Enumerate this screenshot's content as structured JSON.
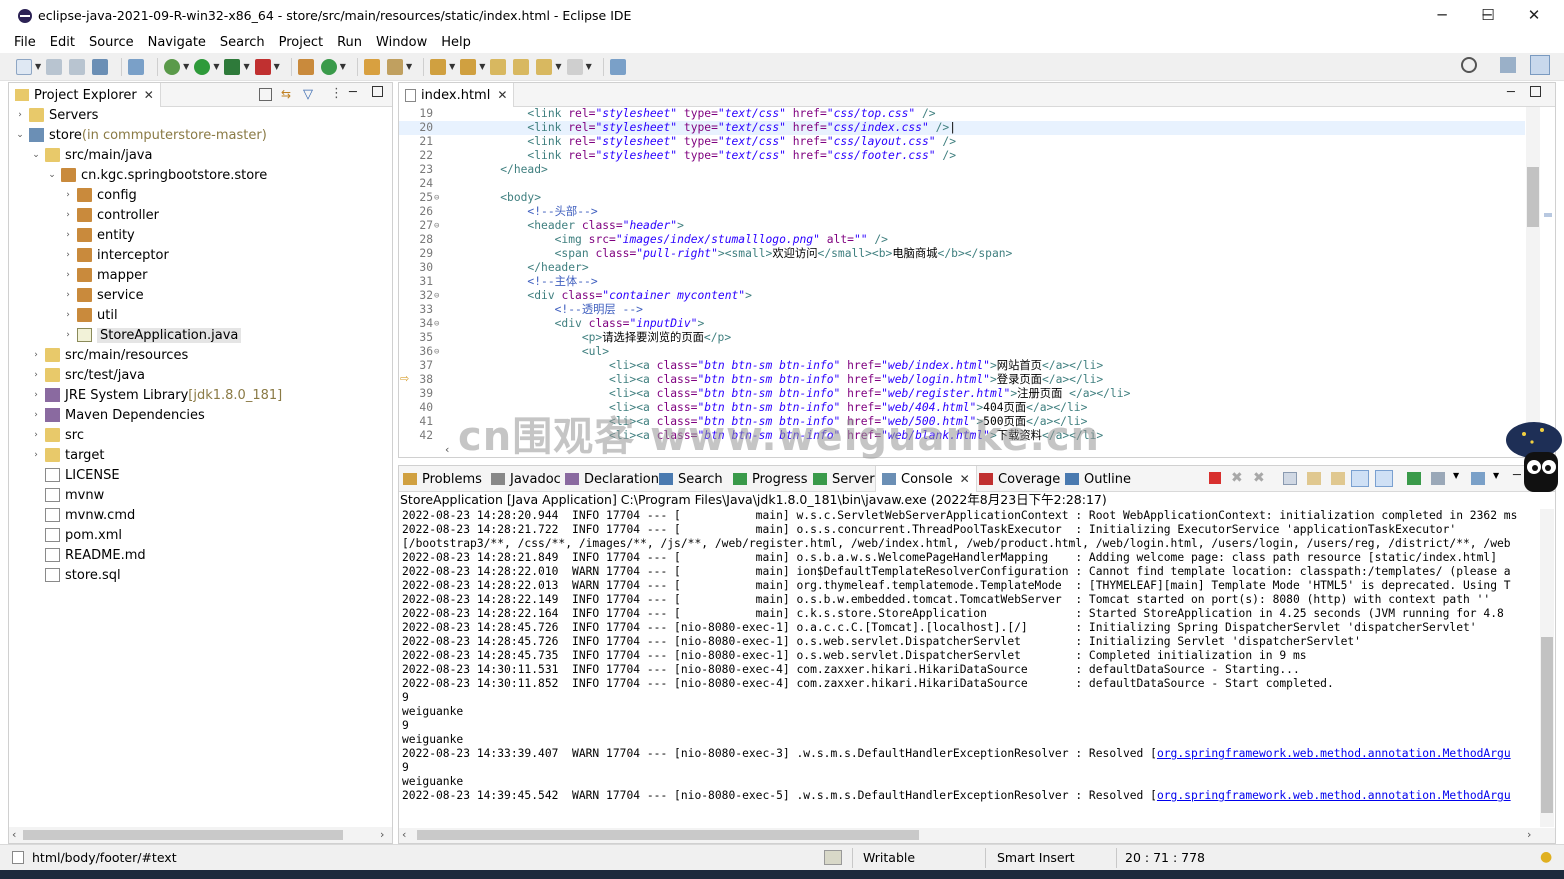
{
  "window": {
    "title": "eclipse-java-2021-09-R-win32-x86_64 - store/src/main/resources/static/index.html - Eclipse IDE",
    "minimize": "─",
    "maximize": "☐",
    "close": "✕"
  },
  "menu": [
    "File",
    "Edit",
    "Source",
    "Navigate",
    "Search",
    "Project",
    "Run",
    "Window",
    "Help"
  ],
  "explorer": {
    "tab_label": "Project Explorer",
    "items": [
      {
        "label": "Servers",
        "extra": ""
      },
      {
        "label": "store",
        "extra": " (in commputerstore-master)"
      },
      {
        "label": "src/main/java",
        "extra": ""
      },
      {
        "label": "cn.kgc.springbootstore.store",
        "extra": ""
      },
      {
        "label": "config",
        "extra": ""
      },
      {
        "label": "controller",
        "extra": ""
      },
      {
        "label": "entity",
        "extra": ""
      },
      {
        "label": "interceptor",
        "extra": ""
      },
      {
        "label": "mapper",
        "extra": ""
      },
      {
        "label": "service",
        "extra": ""
      },
      {
        "label": "util",
        "extra": ""
      },
      {
        "label": "StoreApplication.java",
        "extra": ""
      },
      {
        "label": "src/main/resources",
        "extra": ""
      },
      {
        "label": "src/test/java",
        "extra": ""
      },
      {
        "label": "JRE System Library",
        "extra": " [jdk1.8.0_181]"
      },
      {
        "label": "Maven Dependencies",
        "extra": ""
      },
      {
        "label": "src",
        "extra": ""
      },
      {
        "label": "target",
        "extra": ""
      },
      {
        "label": "LICENSE",
        "extra": ""
      },
      {
        "label": "mvnw",
        "extra": ""
      },
      {
        "label": "mvnw.cmd",
        "extra": ""
      },
      {
        "label": "pom.xml",
        "extra": ""
      },
      {
        "label": "README.md",
        "extra": ""
      },
      {
        "label": "store.sql",
        "extra": ""
      }
    ]
  },
  "editor": {
    "tab_label": "index.html",
    "lines": [
      {
        "n": "19",
        "html": "        <span class='k'>&lt;link</span> <span class='a'>rel=</span><span class='v'>\"stylesheet\"</span> <span class='a'>type=</span><span class='v'>\"text/css\"</span> <span class='a'>href=</span><span class='v'>\"css/top.css\"</span> <span class='k'>/&gt;</span>"
      },
      {
        "n": "20",
        "html": "        <span class='k'>&lt;link</span> <span class='a'>rel=</span><span class='v'>\"stylesheet\"</span> <span class='a'>type=</span><span class='v'>\"text/css\"</span> <span class='a'>href=</span><span class='v'>\"css/index.css\"</span> <span class='k'>/&gt;</span>|"
      },
      {
        "n": "21",
        "html": "        <span class='k'>&lt;link</span> <span class='a'>rel=</span><span class='v'>\"stylesheet\"</span> <span class='a'>type=</span><span class='v'>\"text/css\"</span> <span class='a'>href=</span><span class='v'>\"css/layout.css\"</span> <span class='k'>/&gt;</span>"
      },
      {
        "n": "22",
        "html": "        <span class='k'>&lt;link</span> <span class='a'>rel=</span><span class='v'>\"stylesheet\"</span> <span class='a'>type=</span><span class='v'>\"text/css\"</span> <span class='a'>href=</span><span class='v'>\"css/footer.css\"</span> <span class='k'>/&gt;</span>"
      },
      {
        "n": "23",
        "html": "    <span class='k'>&lt;/head&gt;</span>"
      },
      {
        "n": "24",
        "html": ""
      },
      {
        "n": "25",
        "html": "    <span class='k'>&lt;body&gt;</span>"
      },
      {
        "n": "26",
        "html": "        <span class='c'>&lt;!--头部--&gt;</span>"
      },
      {
        "n": "27",
        "html": "        <span class='k'>&lt;header</span> <span class='a'>class=</span><span class='v'>\"header\"</span><span class='k'>&gt;</span>"
      },
      {
        "n": "28",
        "html": "            <span class='k'>&lt;img</span> <span class='a'>src=</span><span class='v'>\"images/index/stumalllogo.png\"</span> <span class='a'>alt=</span><span class='v'>\"\"</span> <span class='k'>/&gt;</span>"
      },
      {
        "n": "29",
        "html": "            <span class='k'>&lt;span</span> <span class='a'>class=</span><span class='v'>\"pull-right\"</span><span class='k'>&gt;&lt;small&gt;</span>欢迎访问<span class='k'>&lt;/small&gt;&lt;b&gt;</span>电脑商城<span class='k'>&lt;/b&gt;&lt;/span&gt;</span>"
      },
      {
        "n": "30",
        "html": "        <span class='k'>&lt;/header&gt;</span>"
      },
      {
        "n": "31",
        "html": "        <span class='c'>&lt;!--主体--&gt;</span>"
      },
      {
        "n": "32",
        "html": "        <span class='k'>&lt;div</span> <span class='a'>class=</span><span class='v'>\"container mycontent\"</span><span class='k'>&gt;</span>"
      },
      {
        "n": "33",
        "html": "            <span class='c'>&lt;!--透明层 --&gt;</span>"
      },
      {
        "n": "34",
        "html": "            <span class='k'>&lt;div</span> <span class='a'>class=</span><span class='v'>\"inputDiv\"</span><span class='k'>&gt;</span>"
      },
      {
        "n": "35",
        "html": "                <span class='k'>&lt;p&gt;</span>请选择要浏览的页面<span class='k'>&lt;/p&gt;</span>"
      },
      {
        "n": "36",
        "html": "                <span class='k'>&lt;ul&gt;</span>"
      },
      {
        "n": "37",
        "html": "                    <span class='k'>&lt;li&gt;&lt;a</span> <span class='a'>class=</span><span class='v'>\"btn btn-sm btn-info\"</span> <span class='a'>href=</span><span class='v'>\"web/index.html\"</span><span class='k'>&gt;</span>网站首页<span class='k'>&lt;/a&gt;&lt;/li&gt;</span>"
      },
      {
        "n": "38",
        "html": "                    <span class='k'>&lt;li&gt;&lt;a</span> <span class='a'>class=</span><span class='v'>\"btn btn-sm btn-info\"</span> <span class='a'>href=</span><span class='v'>\"web/login.html\"</span><span class='k'>&gt;</span>登录页面<span class='k'>&lt;/a&gt;&lt;/li&gt;</span>"
      },
      {
        "n": "39",
        "html": "                    <span class='k'>&lt;li&gt;&lt;a</span> <span class='a'>class=</span><span class='v'>\"btn btn-sm btn-info\"</span> <span class='a'>href=</span><span class='v'>\"web/register.html\"</span><span class='k'>&gt;</span>注册页面 <span class='k'>&lt;/a&gt;&lt;/li&gt;</span>"
      },
      {
        "n": "40",
        "html": "                    <span class='k'>&lt;li&gt;&lt;a</span> <span class='a'>class=</span><span class='v'>\"btn btn-sm btn-info\"</span> <span class='a'>href=</span><span class='v'>\"web/404.html\"</span><span class='k'>&gt;</span>404页面<span class='k'>&lt;/a&gt;&lt;/li&gt;</span>"
      },
      {
        "n": "41",
        "html": "                    <span class='k'>&lt;li&gt;&lt;a</span> <span class='a'>class=</span><span class='v'>\"btn btn-sm btn-info\"</span> <span class='a'>href=</span><span class='v'>\"web/500.html\"</span><span class='k'>&gt;</span>500页面<span class='k'>&lt;/a&gt;&lt;/li&gt;</span>"
      },
      {
        "n": "42",
        "html": "                    <span class='k'>&lt;li&gt;&lt;a</span> <span class='a'>class=</span><span class='v'>\"btn btn-sm btn-info\"</span> <span class='a'>href=</span><span class='v'>\"web/blank.html\"</span><span class='k'>&gt;</span>下载资料<span class='k'>&lt;/a&gt;&lt;/li&gt;</span>"
      }
    ]
  },
  "console_tabs": [
    "Problems",
    "Javadoc",
    "Declaration",
    "Search",
    "Progress",
    "Servers",
    "Console",
    "Coverage",
    "Outline"
  ],
  "console": {
    "header": "StoreApplication [Java Application] C:\\Program Files\\Java\\jdk1.8.0_181\\bin\\javaw.exe  (2022年8月23日下午2:28:17)",
    "lines": [
      "2022-08-23 14:28:20.944  INFO 17704 --- [           main] w.s.c.ServletWebServerApplicationContext : Root WebApplicationContext: initialization completed in 2362 ms",
      "2022-08-23 14:28:21.722  INFO 17704 --- [           main] o.s.s.concurrent.ThreadPoolTaskExecutor  : Initializing ExecutorService 'applicationTaskExecutor'",
      "[/bootstrap3/**, /css/**, /images/**, /js/**, /web/register.html, /web/index.html, /web/product.html, /web/login.html, /users/login, /users/reg, /district/**, /web",
      "2022-08-23 14:28:21.849  INFO 17704 --- [           main] o.s.b.a.w.s.WelcomePageHandlerMapping    : Adding welcome page: class path resource [static/index.html]",
      "2022-08-23 14:28:22.010  WARN 17704 --- [           main] ion$DefaultTemplateResolverConfiguration : Cannot find template location: classpath:/templates/ (please a",
      "2022-08-23 14:28:22.013  WARN 17704 --- [           main] org.thymeleaf.templatemode.TemplateMode  : [THYMELEAF][main] Template Mode 'HTML5' is deprecated. Using T",
      "2022-08-23 14:28:22.149  INFO 17704 --- [           main] o.s.b.w.embedded.tomcat.TomcatWebServer  : Tomcat started on port(s): 8080 (http) with context path ''",
      "2022-08-23 14:28:22.164  INFO 17704 --- [           main] c.k.s.store.StoreApplication             : Started StoreApplication in 4.25 seconds (JVM running for 4.8",
      "2022-08-23 14:28:45.726  INFO 17704 --- [nio-8080-exec-1] o.a.c.c.C.[Tomcat].[localhost].[/]       : Initializing Spring DispatcherServlet 'dispatcherServlet'",
      "2022-08-23 14:28:45.726  INFO 17704 --- [nio-8080-exec-1] o.s.web.servlet.DispatcherServlet        : Initializing Servlet 'dispatcherServlet'",
      "2022-08-23 14:28:45.735  INFO 17704 --- [nio-8080-exec-1] o.s.web.servlet.DispatcherServlet        : Completed initialization in 9 ms",
      "2022-08-23 14:30:11.531  INFO 17704 --- [nio-8080-exec-4] com.zaxxer.hikari.HikariDataSource       : defaultDataSource - Starting...",
      "2022-08-23 14:30:11.852  INFO 17704 --- [nio-8080-exec-4] com.zaxxer.hikari.HikariDataSource       : defaultDataSource - Start completed.",
      "9",
      "weiguanke",
      "9",
      "weiguanke",
      "2022-08-23 14:33:39.407  WARN 17704 --- [nio-8080-exec-3] .w.s.m.s.DefaultHandlerExceptionResolver : Resolved [",
      "9",
      "weiguanke",
      "2022-08-23 14:39:45.542  WARN 17704 --- [nio-8080-exec-5] .w.s.m.s.DefaultHandlerExceptionResolver : Resolved ["
    ],
    "link_text": "org.springframework.web.method.annotation.MethodArgu"
  },
  "status": {
    "path": "html/body/footer/#text",
    "writable": "Writable",
    "insert_mode": "Smart Insert",
    "position": "20 : 71 : 778"
  },
  "watermark": "cn围观客 www.weiguanke.cn",
  "colors": {
    "tag": "#3f7f7f",
    "attr": "#7f007f",
    "value": "#2a00ff",
    "comment": "#3f5fbf",
    "link": "#0000ee"
  }
}
